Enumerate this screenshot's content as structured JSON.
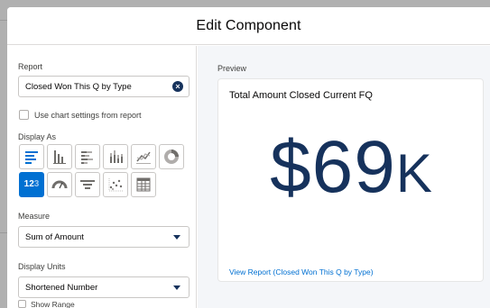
{
  "modal": {
    "title": "Edit Component"
  },
  "report": {
    "label": "Report",
    "value": "Closed Won This Q by Type"
  },
  "chart_settings": {
    "label": "Use chart settings from report",
    "checked": false
  },
  "display_as": {
    "label": "Display As",
    "options": [
      {
        "icon": "horizontal-bar-chart-icon",
        "selected": false
      },
      {
        "icon": "vertical-bar-chart-icon",
        "selected": false
      },
      {
        "icon": "stacked-horizontal-bar-icon",
        "selected": false
      },
      {
        "icon": "stacked-vertical-bar-icon",
        "selected": false
      },
      {
        "icon": "line-chart-icon",
        "selected": false
      },
      {
        "icon": "donut-chart-icon",
        "selected": false
      },
      {
        "icon": "metric-icon",
        "text_main": "12",
        "text_dim": "3",
        "selected": true
      },
      {
        "icon": "gauge-icon",
        "selected": false
      },
      {
        "icon": "funnel-icon",
        "selected": false
      },
      {
        "icon": "scatter-plot-icon",
        "selected": false
      },
      {
        "icon": "table-icon",
        "selected": false
      }
    ]
  },
  "measure": {
    "label": "Measure",
    "value": "Sum of Amount"
  },
  "display_units": {
    "label": "Display Units",
    "value": "Shortened Number"
  },
  "show_range": {
    "label": "Show Range",
    "checked": false
  },
  "preview": {
    "label": "Preview",
    "card_title": "Total Amount Closed Current FQ",
    "metric_value": "$69",
    "metric_unit": "K",
    "view_link": "View Report (Closed Won This Q by Type)"
  },
  "colors": {
    "accent": "#0070d2",
    "navy": "#16325c",
    "panel_bg": "#f4f6f9"
  }
}
